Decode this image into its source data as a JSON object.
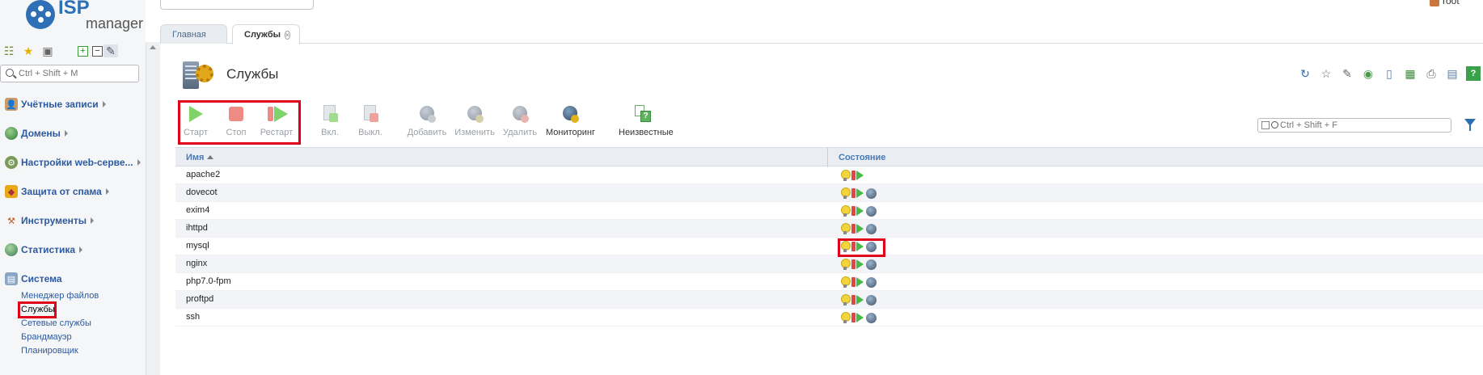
{
  "app": {
    "logo_line1": "ISP",
    "logo_line2": "manager",
    "user": "root"
  },
  "global_search": {
    "placeholder": ""
  },
  "sidebar": {
    "search_placeholder": "Ctrl + Shift + M",
    "groups": [
      {
        "label": "Учётные записи",
        "icon": "users-icon"
      },
      {
        "label": "Домены",
        "icon": "globe-icon"
      },
      {
        "label": "Настройки web-серве...",
        "icon": "gear-icon"
      },
      {
        "label": "Защита от спама",
        "icon": "shield-icon"
      },
      {
        "label": "Инструменты",
        "icon": "tools-icon"
      },
      {
        "label": "Статистика",
        "icon": "chart-icon"
      },
      {
        "label": "Система",
        "icon": "system-icon"
      }
    ],
    "system_items": [
      {
        "label": "Менеджер файлов"
      },
      {
        "label": "Службы"
      },
      {
        "label": "Сетевые службы"
      },
      {
        "label": "Брандмауэр"
      },
      {
        "label": "Планировщик"
      }
    ]
  },
  "tabs": [
    {
      "label": "Главная"
    },
    {
      "label": "Службы"
    }
  ],
  "page": {
    "title": "Службы"
  },
  "toolbar": {
    "start": "Старт",
    "stop": "Стоп",
    "restart": "Рестарт",
    "enable": "Вкл.",
    "disable": "Выкл.",
    "add": "Добавить",
    "edit": "Изменить",
    "delete": "Удалить",
    "monitoring": "Мониторинг",
    "unknown": "Неизвестные",
    "search_placeholder": "Ctrl + Shift + F"
  },
  "table": {
    "columns": [
      "Имя",
      "Состояние"
    ],
    "rows": [
      {
        "name": "apache2",
        "monitored": false
      },
      {
        "name": "dovecot",
        "monitored": true
      },
      {
        "name": "exim4",
        "monitored": true
      },
      {
        "name": "ihttpd",
        "monitored": true
      },
      {
        "name": "mysql",
        "monitored": true
      },
      {
        "name": "nginx",
        "monitored": true
      },
      {
        "name": "php7.0-fpm",
        "monitored": true
      },
      {
        "name": "proftpd",
        "monitored": true
      },
      {
        "name": "ssh",
        "monitored": true
      }
    ]
  },
  "colors": {
    "accent": "#2c5aa0",
    "highlight": "#e0001a",
    "start": "#49b945",
    "stop": "#e2463d"
  }
}
